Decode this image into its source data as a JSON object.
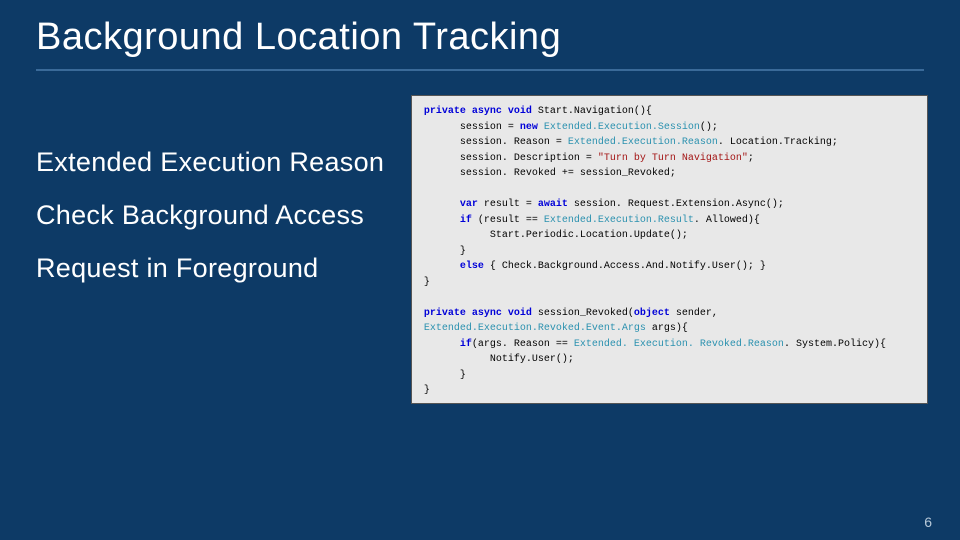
{
  "slide": {
    "title": "Background Location Tracking",
    "number": "6"
  },
  "bullets": {
    "b1": "Extended Execution Reason",
    "b2": "Check Background Access",
    "b3": "Request in Foreground"
  },
  "code": {
    "l01a": "private async void",
    "l01b": " Start.Navigation(){",
    "l02a": "      session = ",
    "l02b": "new",
    "l02c": " Extended.Execution.Session",
    "l02d": "();",
    "l03a": "      session. Reason = ",
    "l03b": "Extended.Execution.Reason",
    "l03c": ". Location.Tracking;",
    "l04a": "      session. Description = ",
    "l04b": "\"Turn by Turn Navigation\"",
    "l04c": ";",
    "l05": "      session. Revoked += session_Revoked;",
    "l06": "",
    "l07a": "      ",
    "l07b": "var",
    "l07c": " result = ",
    "l07d": "await",
    "l07e": " session. Request.Extension.Async();",
    "l08a": "      ",
    "l08b": "if",
    "l08c": " (result == ",
    "l08d": "Extended.Execution.Result",
    "l08e": ". Allowed){",
    "l09": "           Start.Periodic.Location.Update();",
    "l10": "      }",
    "l11a": "      ",
    "l11b": "else",
    "l11c": " { Check.Background.Access.And.Notify.User(); }",
    "l12": "}",
    "l13": "",
    "l14a": "private async void",
    "l14b": " session_Revoked(",
    "l14c": "object",
    "l14d": " sender,",
    "l15a": "Extended.Execution.Revoked.Event.Args",
    "l15b": " args){",
    "l16a": "      ",
    "l16b": "if",
    "l16c": "(args. Reason == ",
    "l16d": "Extended. Execution. Revoked.Reason",
    "l16e": ". System.Policy){",
    "l17": "           Notify.User();",
    "l18": "      }",
    "l19": "}"
  }
}
